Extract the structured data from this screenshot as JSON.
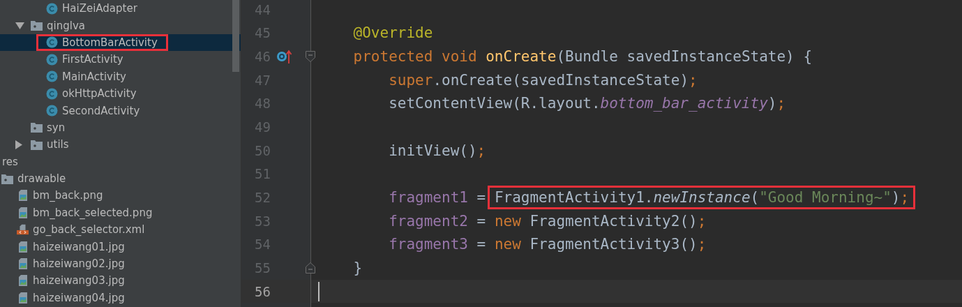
{
  "project_tree": {
    "sections": [
      {
        "kind": "java",
        "items": [
          {
            "kind": "package_hidden",
            "children": [
              {
                "kind": "class",
                "label": "HaiZeiAdapter",
                "selected": false,
                "boxed": false
              }
            ]
          },
          {
            "kind": "package",
            "label": "qinglva",
            "expanded": true,
            "selected": false,
            "boxed": false,
            "children": [
              {
                "kind": "class",
                "label": "BottomBarActivity",
                "selected": true,
                "boxed": true
              },
              {
                "kind": "class",
                "label": "FirstActivity",
                "selected": false,
                "boxed": false
              },
              {
                "kind": "class",
                "label": "MainActivity",
                "selected": false,
                "boxed": false
              },
              {
                "kind": "class",
                "label": "okHttpActivity",
                "selected": false,
                "boxed": false
              },
              {
                "kind": "class",
                "label": "SecondActivity",
                "selected": false,
                "boxed": false
              }
            ]
          },
          {
            "kind": "package",
            "label": "syn",
            "selected": false,
            "boxed": false
          },
          {
            "kind": "package",
            "label": "utils",
            "expanded": false,
            "selected": false,
            "boxed": false
          }
        ]
      },
      {
        "kind": "res",
        "items": [
          {
            "kind": "none",
            "label": "res",
            "selected": false,
            "boxed": false,
            "children": [
              {
                "kind": "package",
                "label": "drawable",
                "selected": false,
                "boxed": false,
                "children": [
                  {
                    "kind": "image_file",
                    "label": "bm_back.png",
                    "selected": false,
                    "boxed": false
                  },
                  {
                    "kind": "image_file",
                    "label": "bm_back_selected.png",
                    "selected": false,
                    "boxed": false
                  },
                  {
                    "kind": "xml_file",
                    "label": "go_back_selector.xml",
                    "selected": false,
                    "boxed": false
                  },
                  {
                    "kind": "image_file",
                    "label": "haizeiwang01.jpg",
                    "selected": false,
                    "boxed": false
                  },
                  {
                    "kind": "image_file",
                    "label": "haizeiwang02.jpg",
                    "selected": false,
                    "boxed": false
                  },
                  {
                    "kind": "image_file",
                    "label": "haizeiwang03.jpg",
                    "selected": false,
                    "boxed": false
                  },
                  {
                    "kind": "image_file",
                    "label": "haizeiwang04.jpg",
                    "selected": false,
                    "boxed": false
                  }
                ]
              }
            ]
          }
        ]
      }
    ]
  },
  "editor": {
    "lines": [
      {
        "number": "44",
        "current": false,
        "override": false
      },
      {
        "number": "45",
        "current": false,
        "override": false,
        "tokens": [
          {
            "text": "    @Override",
            "kind": "annotation"
          }
        ]
      },
      {
        "number": "46",
        "current": false,
        "override": true,
        "fold_start": true,
        "tokens": [
          {
            "text": "    protected void ",
            "kind": "keyword"
          },
          {
            "text": "onCreate",
            "kind": "method"
          },
          {
            "text": "(Bundle savedInstanceState) {",
            "kind": "plain"
          }
        ]
      },
      {
        "number": "47",
        "current": false,
        "override": false,
        "tokens": [
          {
            "text": "        super",
            "kind": "keyword"
          },
          {
            "text": ".onCreate(savedInstanceState)",
            "kind": "plain"
          },
          {
            "text": ";",
            "kind": "keyword"
          }
        ]
      },
      {
        "number": "48",
        "current": false,
        "override": false,
        "tokens": [
          {
            "text": "        setContentView(R.layout.",
            "kind": "plain"
          },
          {
            "text": "bottom_bar_activity",
            "kind": "static_field"
          },
          {
            "text": ")",
            "kind": "plain"
          },
          {
            "text": ";",
            "kind": "keyword"
          }
        ]
      },
      {
        "number": "49",
        "current": false,
        "override": false
      },
      {
        "number": "50",
        "current": false,
        "override": false,
        "tokens": [
          {
            "text": "        initView()",
            "kind": "plain"
          },
          {
            "text": ";",
            "kind": "keyword"
          }
        ]
      },
      {
        "number": "51",
        "current": false,
        "override": false
      },
      {
        "number": "52",
        "current": false,
        "override": false,
        "tokens": [
          {
            "text": "        fragment1",
            "kind": "field"
          },
          {
            "text": " = ",
            "kind": "plain"
          }
        ],
        "boxed_tokens": [
          {
            "text": "FragmentActivity1.",
            "kind": "plain"
          },
          {
            "text": "newInstance",
            "kind": "static_call"
          },
          {
            "text": "(",
            "kind": "plain"
          },
          {
            "text": "\"Good Morning~\"",
            "kind": "string"
          },
          {
            "text": ")",
            "kind": "plain"
          },
          {
            "text": ";",
            "kind": "keyword"
          }
        ]
      },
      {
        "number": "53",
        "current": false,
        "override": false,
        "tokens": [
          {
            "text": "        fragment2",
            "kind": "field"
          },
          {
            "text": " = ",
            "kind": "plain"
          },
          {
            "text": "new",
            "kind": "keyword"
          },
          {
            "text": " FragmentActivity2()",
            "kind": "plain"
          },
          {
            "text": ";",
            "kind": "keyword"
          }
        ]
      },
      {
        "number": "54",
        "current": false,
        "override": false,
        "tokens": [
          {
            "text": "        fragment3",
            "kind": "field"
          },
          {
            "text": " = ",
            "kind": "plain"
          },
          {
            "text": "new",
            "kind": "keyword"
          },
          {
            "text": " FragmentActivity3()",
            "kind": "plain"
          },
          {
            "text": ";",
            "kind": "keyword"
          }
        ]
      },
      {
        "number": "55",
        "current": false,
        "override": false,
        "fold_end": true,
        "tokens": [
          {
            "text": "    }",
            "kind": "plain"
          }
        ]
      },
      {
        "number": "56",
        "current": true,
        "override": false
      }
    ]
  }
}
